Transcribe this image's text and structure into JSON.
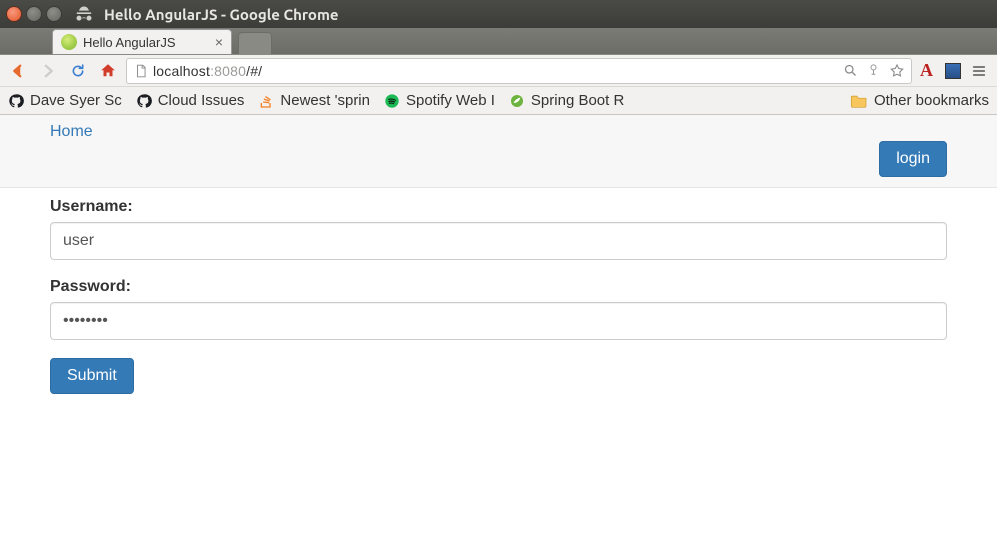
{
  "window": {
    "title": "Hello AngularJS - Google Chrome"
  },
  "tab": {
    "title": "Hello AngularJS"
  },
  "url": {
    "host": "localhost",
    "port": ":8080",
    "path": "/#/"
  },
  "bookmarks": {
    "items": [
      {
        "label": "Dave Syer Sc",
        "icon": "github"
      },
      {
        "label": "Cloud Issues",
        "icon": "github"
      },
      {
        "label": "Newest 'sprin",
        "icon": "stackoverflow"
      },
      {
        "label": "Spotify Web I",
        "icon": "spotify"
      },
      {
        "label": "Spring Boot R",
        "icon": "spring"
      }
    ],
    "other_label": "Other bookmarks"
  },
  "nav": {
    "home_label": "Home",
    "login_label": "login"
  },
  "form": {
    "username_label": "Username:",
    "username_value": "user",
    "password_label": "Password:",
    "password_value": "••••••••",
    "submit_label": "Submit"
  }
}
